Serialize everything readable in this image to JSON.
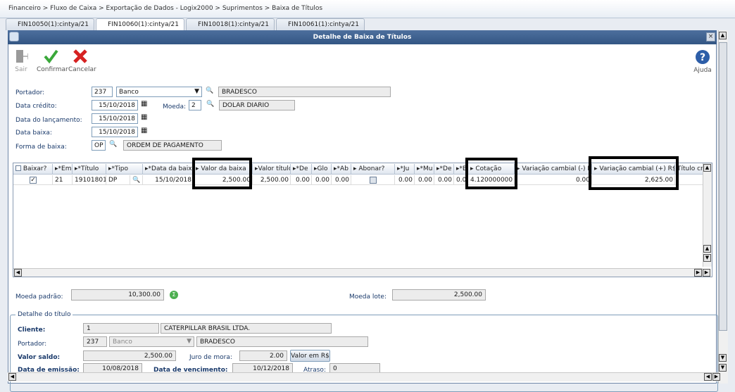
{
  "breadcrumb": "Financeiro > Fluxo de Caixa > Exportação de Dados - Logix2000 > Suprimentos > Baixa de Títulos",
  "tabs": [
    "FIN10050(1):cintya/21",
    "FIN10060(1):cintya/21",
    "FIN10018(1):cintya/21",
    "FIN10061(1):cintya/21"
  ],
  "window_title": "Detalhe de Baixa de Títulos",
  "toolbar": {
    "sair": "Sair",
    "confirmar": "Confirmar",
    "cancelar": "Cancelar",
    "ajuda": "Ajuda"
  },
  "form": {
    "portador_label": "Portador:",
    "portador_code": "237",
    "portador_type": "Banco",
    "portador_name": "BRADESCO",
    "data_credito_label": "Data crédito:",
    "data_credito": "15/10/2018",
    "moeda_label": "Moeda:",
    "moeda_code": "2",
    "moeda_name": "DOLAR DIARIO",
    "data_lancamento_label": "Data do lançamento:",
    "data_lancamento": "15/10/2018",
    "data_baixa_label": "Data baixa:",
    "data_baixa": "15/10/2018",
    "forma_baixa_label": "Forma de  baixa:",
    "forma_baixa_code": "OP",
    "forma_baixa_name": "ORDEM DE PAGAMENTO"
  },
  "grid": {
    "headers": [
      "Baixar?",
      "*Em",
      "*Título",
      "*Tipo",
      "*Data da baixa",
      "Valor da baixa",
      "Valor título",
      "*De",
      "Glo",
      "*Ab",
      "Abonar?",
      "*Ju",
      "*Mu",
      "*De",
      "*Be",
      "Cotação",
      "Variação cambial (-) R$",
      "Variação cambial (+) R$",
      "Título cré"
    ],
    "row": [
      "",
      "21",
      "19101801",
      "DP",
      "",
      "15/10/2018",
      "2,500.00",
      "2,500.00",
      "0.00",
      "0.00",
      "0.00",
      "",
      "0.00",
      "0.00",
      "0.00",
      "0.00",
      "4.120000000",
      "0.00",
      "2,625.00"
    ]
  },
  "totals": {
    "moeda_padrao_label": "Moeda padrão:",
    "moeda_padrao": "10,300.00",
    "moeda_lote_label": "Moeda lote:",
    "moeda_lote": "2,500.00"
  },
  "detalhe": {
    "legend": "Detalhe do título",
    "cliente_label": "Cliente:",
    "cliente_code": "1",
    "cliente_name": "CATERPILLAR BRASIL LTDA.",
    "portador_label": "Portador:",
    "portador_code": "237",
    "portador_type": "Banco",
    "portador_name": "BRADESCO",
    "valor_saldo_label": "Valor saldo:",
    "valor_saldo": "2,500.00",
    "juro_mora_label": "Juro de mora:",
    "juro_mora": "2.00",
    "valor_rs_button": "Valor em R$",
    "data_emissao_label": "Data de emissão:",
    "data_emissao": "10/08/2018",
    "data_vencimento_label": "Data de vencimento:",
    "data_vencimento": "10/12/2018",
    "atraso_label": "Atraso:",
    "atraso": "0"
  }
}
